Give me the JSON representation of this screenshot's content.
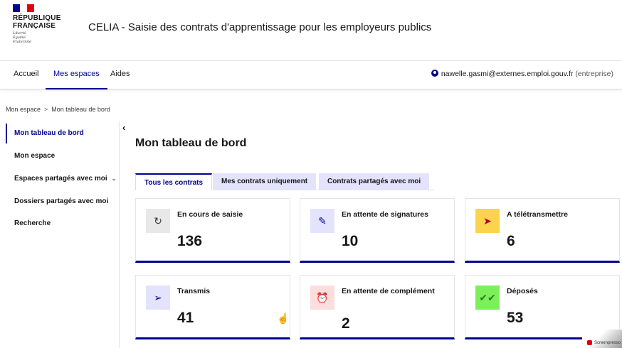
{
  "header": {
    "logo_lines": [
      "RÉPUBLIQUE",
      "FRANÇAISE"
    ],
    "motto_lines": [
      "Liberté",
      "Égalité",
      "Fraternité"
    ],
    "app_title": "CELIA - Saisie des contrats d'apprentissage pour les employeurs publics",
    "flag_colors": [
      "#000091",
      "#ffffff",
      "#e1000f"
    ]
  },
  "nav": {
    "items": [
      "Accueil",
      "Mes espaces",
      "Aides"
    ],
    "active": "Mes espaces",
    "user_email": "nawelle.gasmi@externes.emploi.gouv.fr",
    "user_role": "(entreprise)"
  },
  "breadcrumb": {
    "items": [
      "Mon espace",
      "Mon tableau de bord"
    ],
    "separator": ">"
  },
  "sidebar": {
    "items": [
      "Mon tableau de bord",
      "Mon espace",
      "Espaces partagés avec moi",
      "Dossiers partagés avec moi",
      "Recherche"
    ],
    "active": "Mon tableau de bord",
    "expand_glyph": "⌄",
    "collapse_glyph": "‹"
  },
  "main": {
    "title": "Mon tableau de bord",
    "tabs": [
      "Tous les contrats",
      "Mes contrats uniquement",
      "Contrats partagés avec moi"
    ],
    "active_tab": "Tous les contrats"
  },
  "cards": [
    {
      "label": "En cours de saisie",
      "value": "136",
      "icon": "refresh-icon",
      "glyph": "↻",
      "icon_bg": "#e8e8e8",
      "icon_color": "#3a3a3a"
    },
    {
      "label": "En attente de signatures",
      "value": "10",
      "icon": "sign-icon",
      "glyph": "✎",
      "icon_bg": "#e3e3fd",
      "icon_color": "#000091"
    },
    {
      "label": "A télétransmettre",
      "value": "6",
      "icon": "send-clock-icon",
      "glyph": "➤",
      "icon_bg": "#fcd34d",
      "icon_color": "#b3001b"
    },
    {
      "label": "Transmis",
      "value": "41",
      "icon": "sent-icon",
      "glyph": "➢",
      "icon_bg": "#e3e3fd",
      "icon_color": "#000091"
    },
    {
      "label": "En attente de complément",
      "value": "2",
      "icon": "alarm-icon",
      "glyph": "⏰",
      "icon_bg": "#fddddd",
      "icon_color": "#c9191e"
    },
    {
      "label": "Déposés",
      "value": "53",
      "icon": "double-check-icon",
      "glyph": "✔✔",
      "icon_bg": "#7cf05a",
      "icon_color": "#2f7a1e"
    }
  ],
  "watermark": "Screenpresso"
}
